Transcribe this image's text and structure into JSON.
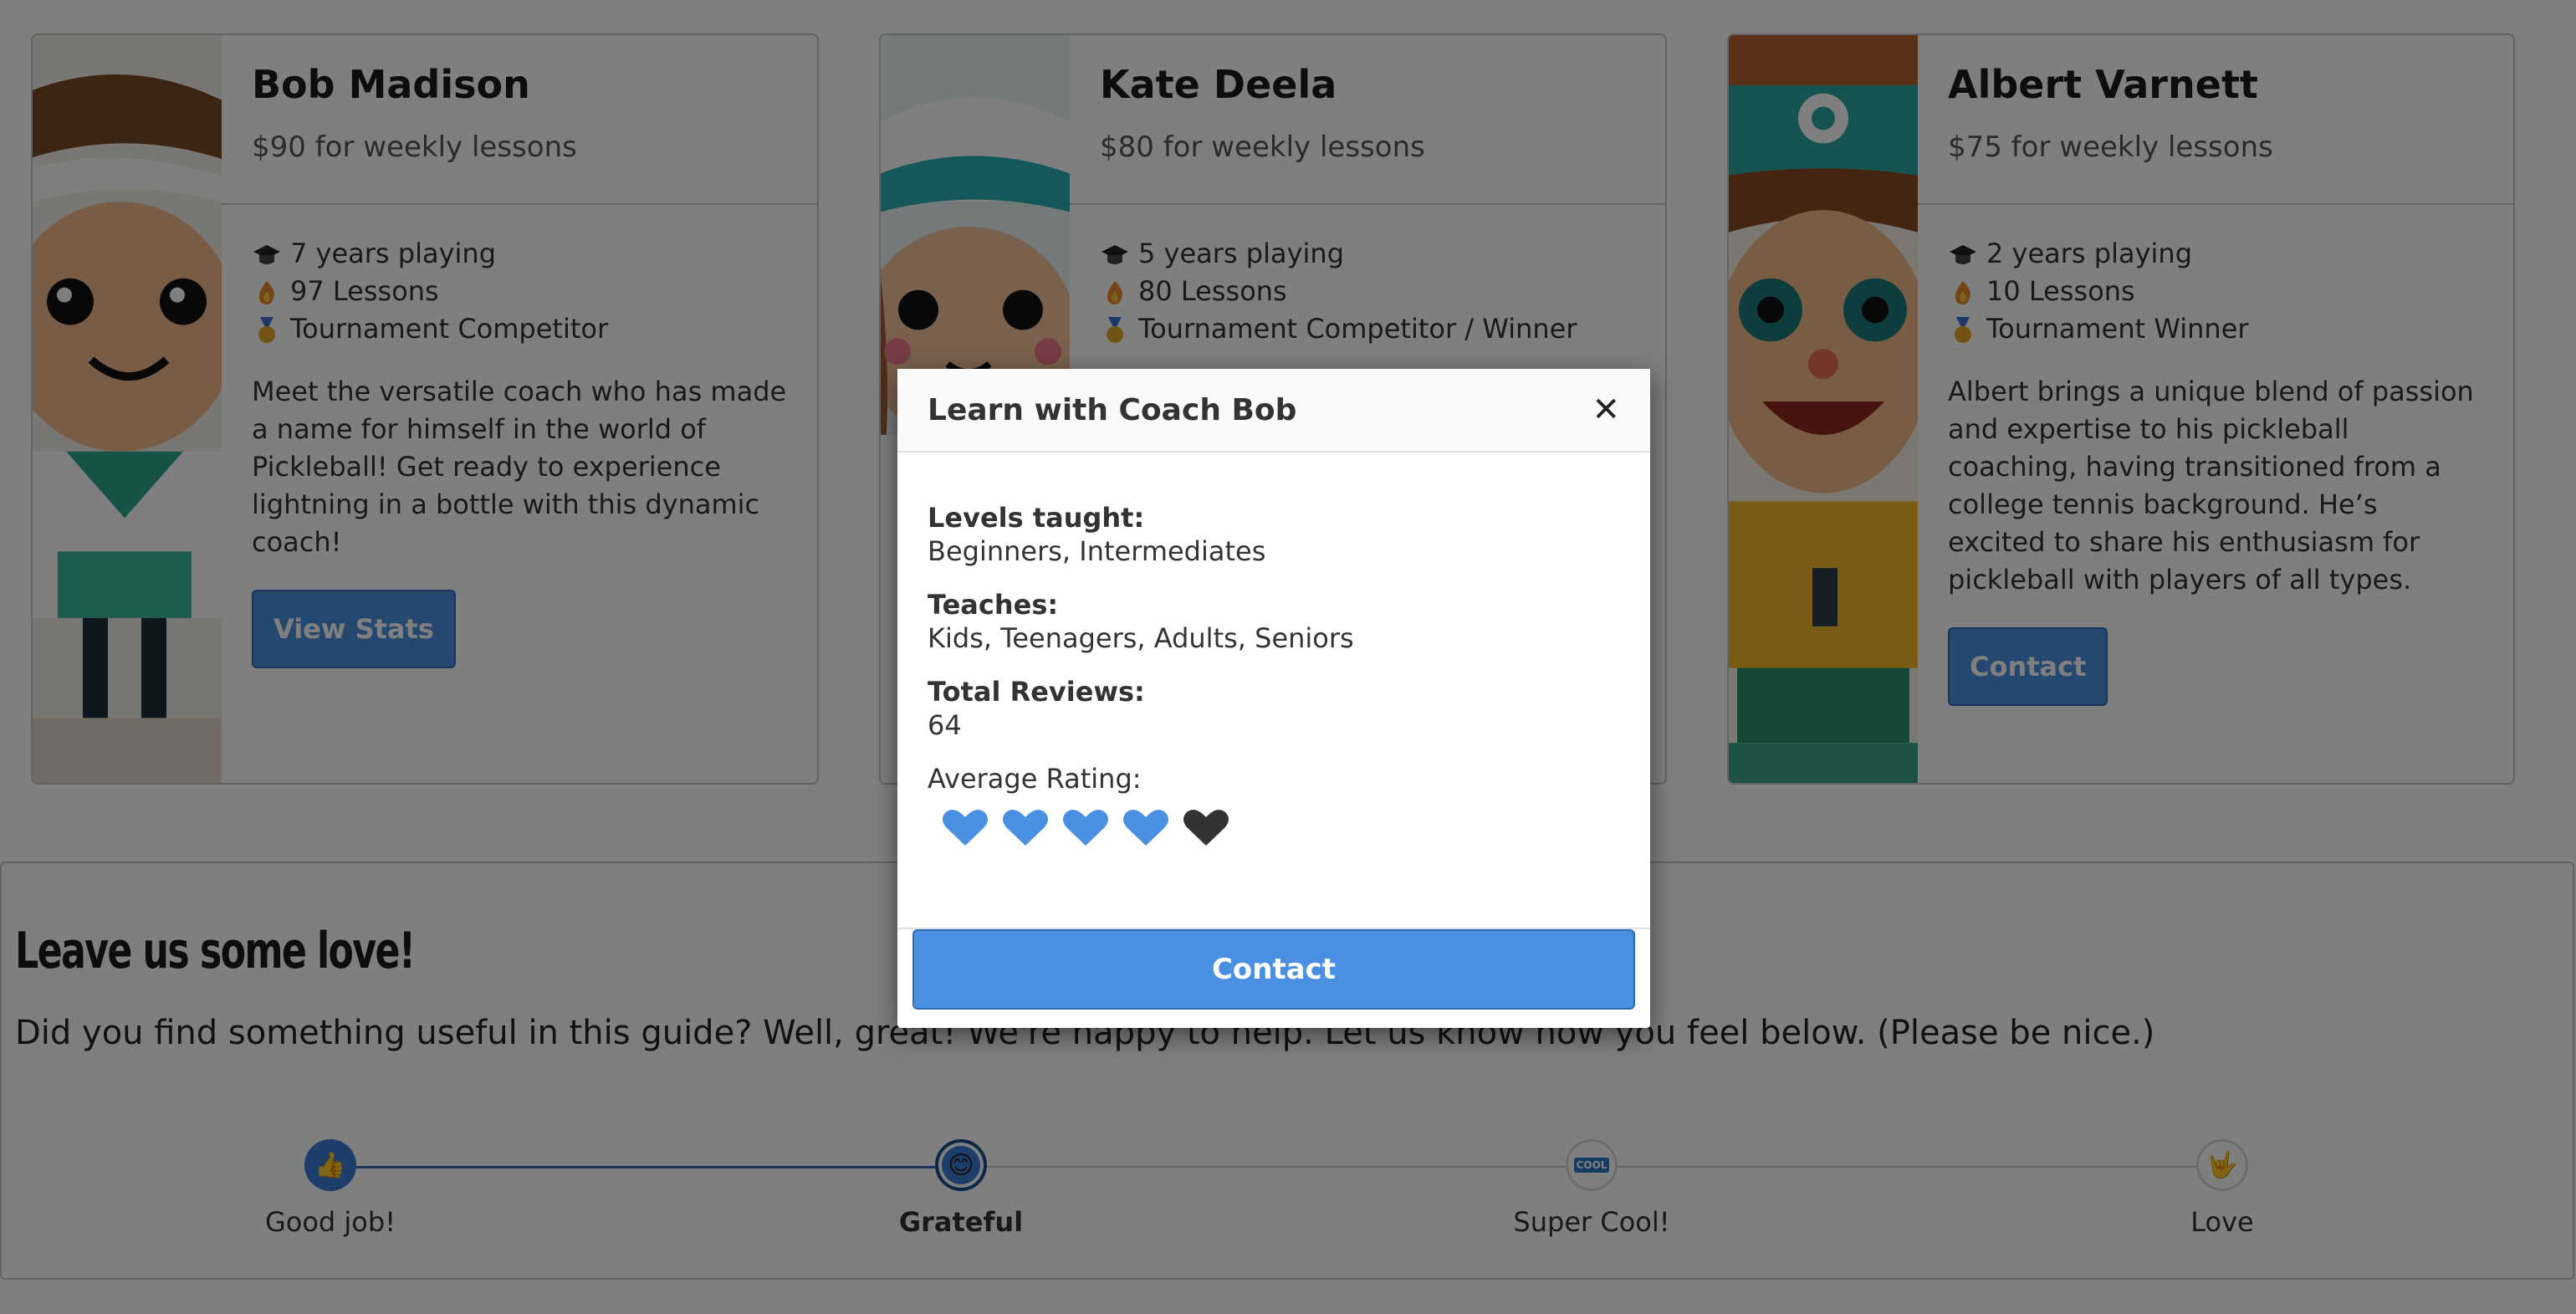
{
  "coaches": [
    {
      "name": "Bob Madison",
      "price": "$90 for weekly lessons",
      "stats": [
        "7 years playing",
        "97 Lessons",
        "Tournament Competitor"
      ],
      "description": "Meet the versatile coach who has made a name for himself in the world of Pickleball! Get ready to experience lightning in a bottle with this dynamic coach!",
      "button": "View Stats"
    },
    {
      "name": "Kate Deela",
      "price": "$80 for weekly lessons",
      "stats": [
        "5 years playing",
        "80 Lessons",
        "Tournament Competitor / Winner"
      ],
      "description": "",
      "button": ""
    },
    {
      "name": "Albert Varnett",
      "price": "$75 for weekly lessons",
      "stats": [
        "2 years playing",
        "10 Lessons",
        "Tournament Winner"
      ],
      "description": "Albert brings a unique blend of passion and expertise to his pickleball coaching, having transitioned from a college tennis background. He’s excited to share his enthusiasm for pickleball with players of all types.",
      "button": "Contact"
    }
  ],
  "feedback": {
    "title": "Leave us some love!",
    "text": "Did you find something useful in this guide? Well, great! We're happy to help. Let us know how you feel below. (Please be nice.)",
    "steps": [
      {
        "label": "Good job!",
        "icon": "thumbs-up-icon"
      },
      {
        "label": "Grateful",
        "icon": "smile-icon"
      },
      {
        "label": "Super Cool!",
        "icon": "cool-icon"
      },
      {
        "label": "Love",
        "icon": "love-hand-icon"
      }
    ],
    "selected": "Grateful"
  },
  "modal": {
    "title": "Learn with Coach Bob",
    "levels_label": "Levels taught:",
    "levels_value": "Beginners, Intermediates",
    "teaches_label": "Teaches:",
    "teaches_value": "Kids, Teenagers, Adults, Seniors",
    "reviews_label": "Total Reviews:",
    "reviews_value": "64",
    "rating_label": "Average Rating:",
    "rating": 4,
    "rating_max": 5,
    "button": "Contact"
  },
  "colors": {
    "accent": "#4a90e2",
    "heart_filled": "#4a90e2",
    "heart_empty": "#333333",
    "overlay": "rgba(0,0,0,0.5)"
  }
}
